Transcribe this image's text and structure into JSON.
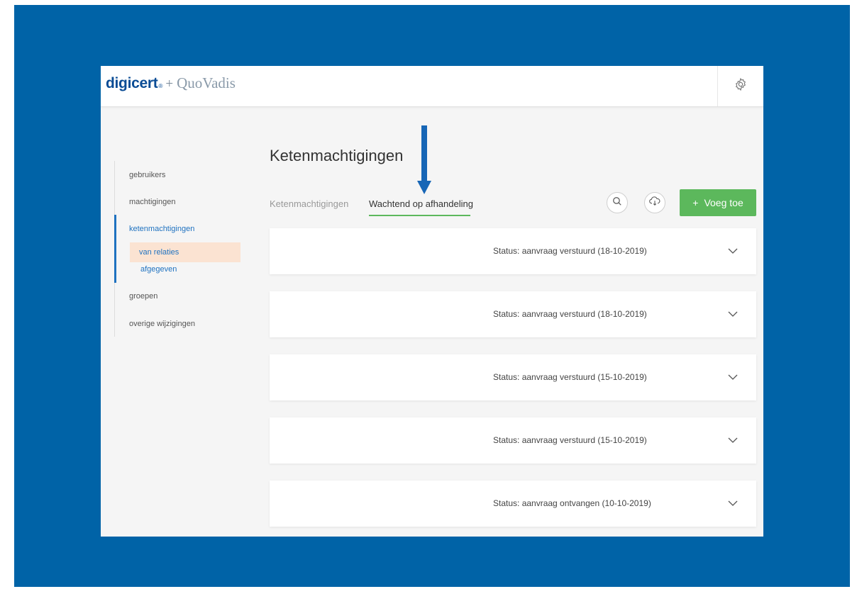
{
  "header": {
    "logo_primary": "digicert",
    "logo_reg": "®",
    "logo_plus": "+",
    "logo_secondary": "QuoVadis",
    "settings_icon": "gear-icon"
  },
  "sidebar": {
    "items": [
      {
        "label": "gebruikers"
      },
      {
        "label": "machtigingen"
      },
      {
        "label": "ketenmachtigingen"
      },
      {
        "label": "groepen"
      },
      {
        "label": "overige wijzigingen"
      }
    ],
    "subitems": [
      {
        "label": "van relaties"
      },
      {
        "label": "afgegeven"
      }
    ]
  },
  "main": {
    "title": "Ketenmachtigingen",
    "tabs": [
      {
        "label": "Ketenmachtigingen"
      },
      {
        "label": "Wachtend op afhandeling"
      }
    ],
    "add_button": {
      "plus": "+",
      "label": "Voeg toe"
    },
    "cards": [
      {
        "status": "Status: aanvraag verstuurd (18-10-2019)"
      },
      {
        "status": "Status: aanvraag verstuurd (18-10-2019)"
      },
      {
        "status": "Status: aanvraag verstuurd (15-10-2019)"
      },
      {
        "status": "Status: aanvraag verstuurd (15-10-2019)"
      },
      {
        "status": "Status: aanvraag ontvangen (10-10-2019)"
      }
    ]
  },
  "colors": {
    "backdrop": "#0063a7",
    "accent_green": "#5cb85c",
    "link_blue": "#1f72c0",
    "selected_bg": "#fbe3d2"
  }
}
